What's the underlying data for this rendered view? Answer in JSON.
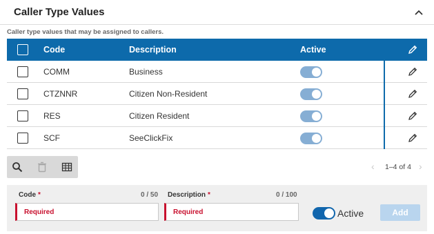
{
  "panel": {
    "title": "Caller Type Values",
    "subtitle": "Caller type values that may be assigned to callers."
  },
  "table": {
    "columns": {
      "code": "Code",
      "description": "Description",
      "active": "Active"
    },
    "rows": [
      {
        "code": "COMM",
        "description": "Business",
        "active": true
      },
      {
        "code": "CTZNNR",
        "description": "Citizen Non-Resident",
        "active": true
      },
      {
        "code": "RES",
        "description": "Citizen Resident",
        "active": true
      },
      {
        "code": "SCF",
        "description": "SeeClickFix",
        "active": true
      }
    ]
  },
  "toolbar": {
    "icons": [
      "search-icon",
      "trash-icon",
      "table-grid-icon"
    ]
  },
  "pagination": {
    "range": "1–4 of 4"
  },
  "form": {
    "code": {
      "label": "Code",
      "counter": "0 / 50",
      "placeholder": "Required"
    },
    "description": {
      "label": "Description",
      "counter": "0 / 100",
      "placeholder": "Required"
    },
    "active_label": "Active",
    "add_label": "Add"
  },
  "colors": {
    "header_bg": "#0d6aab",
    "toggle_on_light": "#86aed4",
    "toggle_on": "#1166ad",
    "required": "#c8102e",
    "add_disabled": "#b9d5ee"
  }
}
